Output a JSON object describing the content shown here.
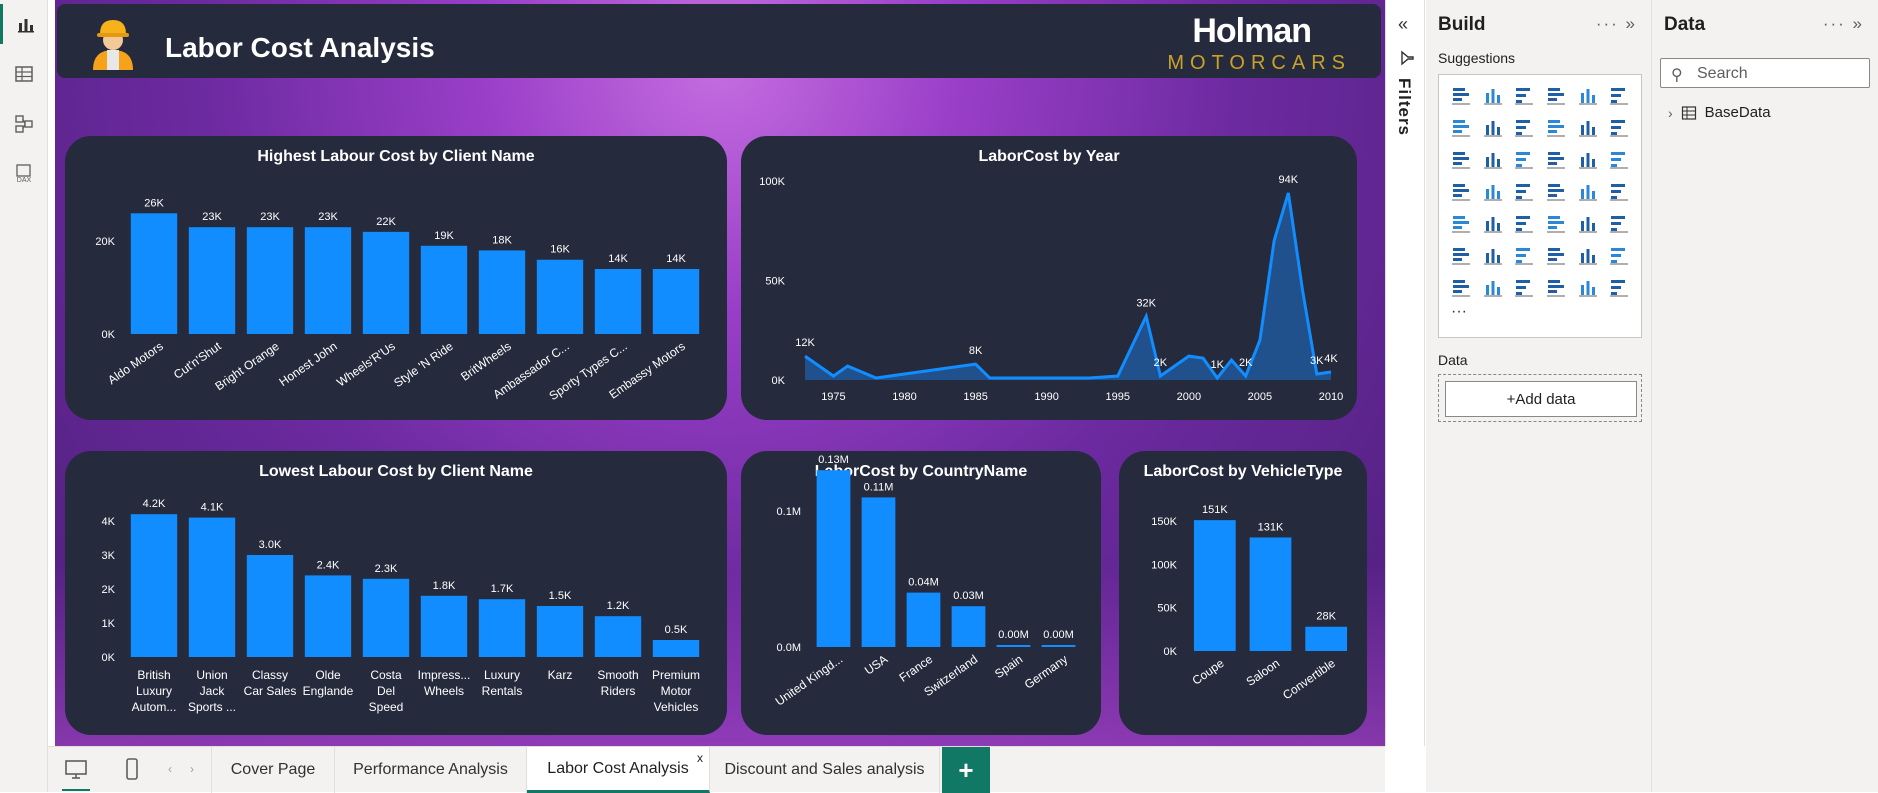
{
  "report": {
    "title": "Labor Cost Analysis",
    "brand_line1": "Holman",
    "brand_line2": "MOTORCARS"
  },
  "left_rail": {
    "items": [
      {
        "icon": "report-view-icon",
        "active": true
      },
      {
        "icon": "table-view-icon",
        "active": false
      },
      {
        "icon": "model-view-icon",
        "active": false
      },
      {
        "icon": "dax-query-icon",
        "label": "DAX",
        "active": false
      }
    ]
  },
  "charts": {
    "highest": {
      "chart_data": {
        "type": "bar",
        "title": "Highest Labour Cost by Client Name",
        "categories": [
          "Aldo Motors",
          "Cut'n'Shut",
          "Bright Orange",
          "Honest John",
          "Wheels'R'Us",
          "Style 'N Ride",
          "BritWheels",
          "Ambassador C...",
          "Sporty Types C...",
          "Embassy Motors"
        ],
        "values": [
          26000,
          23000,
          23000,
          23000,
          22000,
          19000,
          18000,
          16000,
          14000,
          14000
        ],
        "data_labels": [
          "26K",
          "23K",
          "23K",
          "23K",
          "22K",
          "19K",
          "18K",
          "16K",
          "14K",
          "14K"
        ],
        "yticks": [
          "0K",
          "20K"
        ],
        "ylim": [
          0,
          28000
        ],
        "grid": false,
        "color": "#118dff"
      }
    },
    "year": {
      "chart_data": {
        "type": "area",
        "title": "LaborCost by Year",
        "x": [
          1973,
          1975,
          1976,
          1978,
          1980,
          1985,
          1986,
          1990,
          1993,
          1995,
          1997,
          1998,
          2000,
          2001,
          2002,
          2003,
          2004,
          2005,
          2006,
          2007,
          2008,
          2009,
          2010
        ],
        "values": [
          12000,
          2000,
          7000,
          1000,
          3000,
          8000,
          1000,
          1000,
          1000,
          2000,
          32000,
          2000,
          12000,
          11000,
          1000,
          10000,
          2000,
          20000,
          70000,
          94000,
          45000,
          3000,
          4000
        ],
        "data_labels": [
          {
            "x": 1973,
            "text": "12K"
          },
          {
            "x": 1985,
            "text": "8K"
          },
          {
            "x": 1997,
            "text": "32K"
          },
          {
            "x": 1998,
            "text": "2K"
          },
          {
            "x": 2002,
            "text": "1K"
          },
          {
            "x": 2004,
            "text": "2K"
          },
          {
            "x": 2007,
            "text": "94K"
          },
          {
            "x": 2009,
            "text": "3K"
          },
          {
            "x": 2010,
            "text": "4K"
          }
        ],
        "xticks": [
          1975,
          1980,
          1985,
          1990,
          1995,
          2000,
          2005,
          2010
        ],
        "yticks": [
          "0K",
          "50K",
          "100K"
        ],
        "ylim": [
          0,
          100000
        ],
        "xlim": [
          1973,
          2010
        ],
        "color": "#118dff"
      }
    },
    "lowest": {
      "chart_data": {
        "type": "bar",
        "title": "Lowest Labour Cost by Client Name",
        "categories": [
          [
            "British",
            "Luxury",
            "Autom..."
          ],
          [
            "Union",
            "Jack",
            "Sports ..."
          ],
          [
            "Classy",
            "Car Sales"
          ],
          [
            "Olde",
            "Englande"
          ],
          [
            "Costa",
            "Del",
            "Speed"
          ],
          [
            "Impress...",
            "Wheels"
          ],
          [
            "Luxury",
            "Rentals"
          ],
          [
            "Karz"
          ],
          [
            "Smooth",
            "Riders"
          ],
          [
            "Premium",
            "Motor",
            "Vehicles"
          ]
        ],
        "values": [
          4200,
          4100,
          3000,
          2400,
          2300,
          1800,
          1700,
          1500,
          1200,
          500
        ],
        "data_labels": [
          "4.2K",
          "4.1K",
          "3.0K",
          "2.4K",
          "2.3K",
          "1.8K",
          "1.7K",
          "1.5K",
          "1.2K",
          "0.5K"
        ],
        "yticks": [
          "0K",
          "1K",
          "2K",
          "3K",
          "4K"
        ],
        "ylim": [
          0,
          4000
        ],
        "color": "#118dff"
      }
    },
    "country": {
      "chart_data": {
        "type": "bar",
        "title": "LaborCost by CountryName",
        "categories": [
          "United Kingd...",
          "USA",
          "France",
          "Switzerland",
          "Spain",
          "Germany"
        ],
        "values": [
          130000,
          110000,
          40000,
          30000,
          1000,
          1000
        ],
        "data_labels": [
          "0.13M",
          "0.11M",
          "0.04M",
          "0.03M",
          "0.00M",
          "0.00M"
        ],
        "yticks": [
          "0.0M",
          "0.1M"
        ],
        "ylim": [
          0,
          100000
        ],
        "color": "#118dff"
      }
    },
    "vehicle": {
      "chart_data": {
        "type": "bar",
        "title": "LaborCost by VehicleType",
        "categories": [
          "Coupe",
          "Saloon",
          "Convertible"
        ],
        "values": [
          151000,
          131000,
          28000
        ],
        "data_labels": [
          "151K",
          "131K",
          "28K"
        ],
        "yticks": [
          "0K",
          "50K",
          "100K",
          "150K"
        ],
        "ylim": [
          0,
          150000
        ],
        "color": "#118dff"
      }
    }
  },
  "tabs": {
    "items": [
      {
        "label": "Cover Page",
        "active": false
      },
      {
        "label": "Performance Analysis",
        "active": false
      },
      {
        "label": "Labor Cost Analysis",
        "active": true,
        "close": "x"
      },
      {
        "label": "Discount and Sales analysis",
        "active": false
      }
    ],
    "add_label": "+"
  },
  "filters_pane": {
    "label": "Filters"
  },
  "build_pane": {
    "title": "Build",
    "actions": "···",
    "suggestions_label": "Suggestions",
    "more": "···",
    "data_label": "Data",
    "add_data_label": "+Add data",
    "visuals": [
      [
        "stacked-bar-icon",
        "stacked-column-icon",
        "clustered-bar-icon",
        "clustered-column-icon",
        "100-stacked-bar-icon",
        "100-stacked-column-icon"
      ],
      [
        "line-chart-icon",
        "area-chart-icon",
        "stacked-area-icon",
        "ribbon-chart-icon",
        "line-column-icon",
        "line-stacked-column-icon"
      ],
      [
        "waterfall-icon",
        "column-combo-icon",
        "funnel-icon",
        "scatter-icon",
        "pie-chart-icon",
        "donut-chart-icon"
      ],
      [
        "treemap-icon",
        "map-icon",
        "filled-map-icon",
        "azure-map-icon",
        "gauge-icon",
        "card-icon"
      ],
      [
        "multi-row-card-icon",
        "kpi-icon",
        "slicer-icon",
        "table-icon",
        "matrix-icon",
        "r-visual-icon"
      ],
      [
        "python-visual-icon",
        "key-influencers-icon",
        "decomposition-tree-icon",
        "qa-icon",
        "smart-narrative-icon",
        "metrics-icon"
      ],
      [
        "paginated-report-icon",
        "power-apps-icon",
        "power-automate-icon",
        "custom-visual-icon",
        "power-bi-visual-icon",
        "chevron-visual-icon"
      ]
    ]
  },
  "data_pane": {
    "title": "Data",
    "actions": "···",
    "search_placeholder": "Search",
    "tables": [
      "BaseData"
    ]
  }
}
